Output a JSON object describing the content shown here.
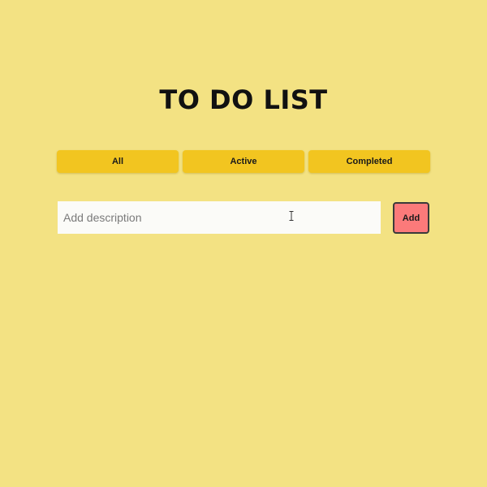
{
  "header": {
    "title": "TO DO LIST"
  },
  "filters": {
    "all_label": "All",
    "active_label": "Active",
    "completed_label": "Completed"
  },
  "new_task": {
    "placeholder": "Add description",
    "value": "",
    "add_label": "Add"
  },
  "colors": {
    "background": "#f3e283",
    "filter_button": "#f2c520",
    "add_button": "#fb7a7a",
    "input_background": "#fbfbf8",
    "title": "#111111"
  },
  "icons": {
    "cursor": "text-cursor-icon"
  }
}
